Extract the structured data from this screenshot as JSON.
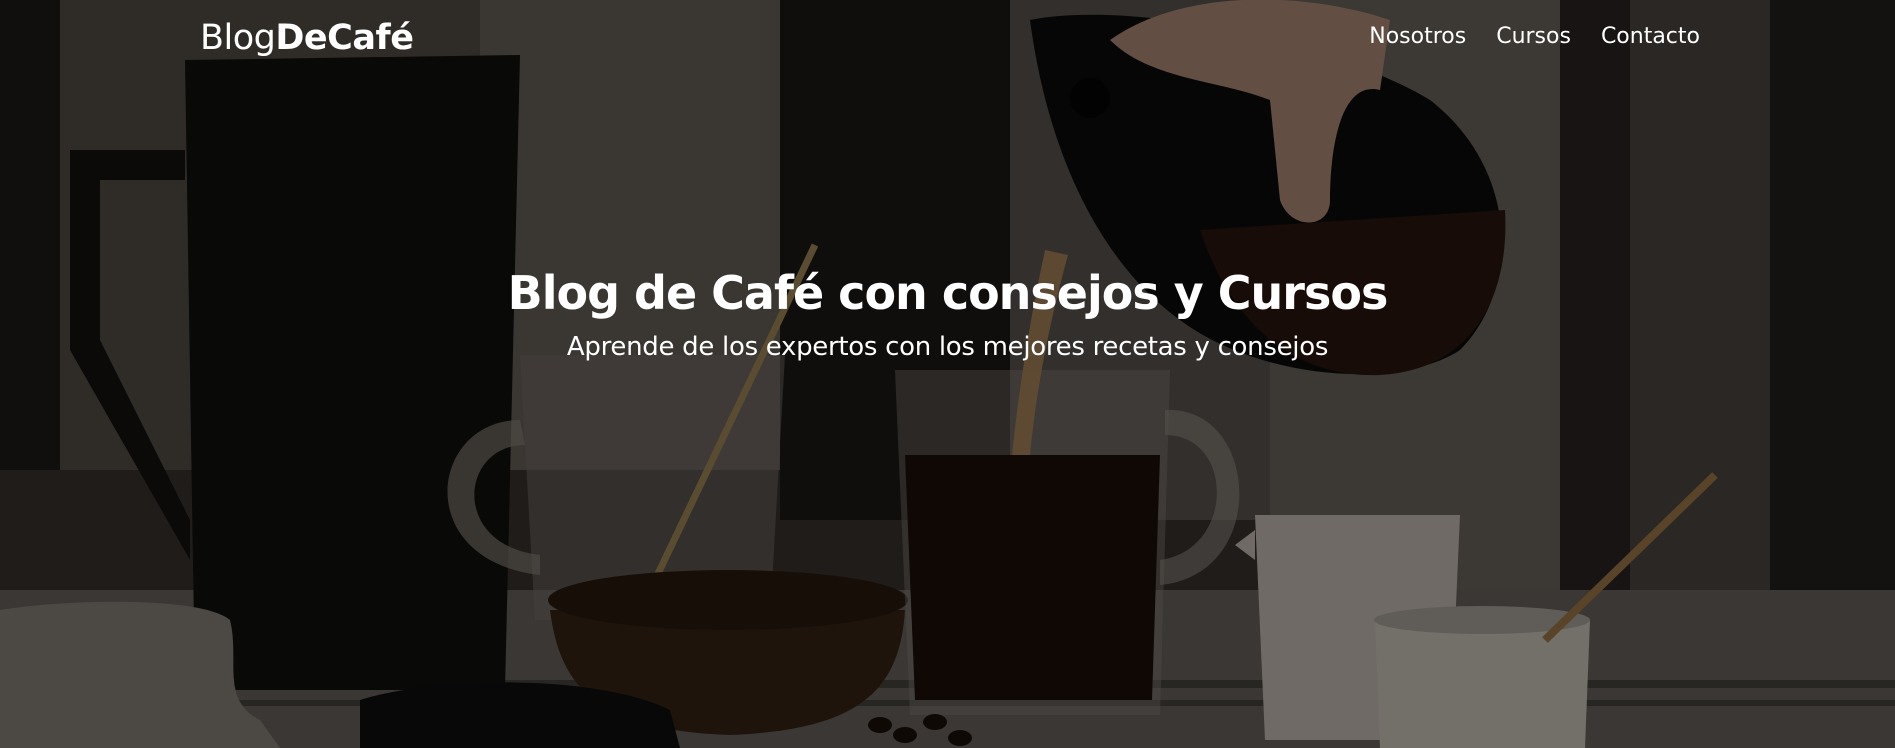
{
  "header": {
    "logo_light": "Blog",
    "logo_bold": "DeCafé",
    "nav": [
      {
        "label": "Nosotros"
      },
      {
        "label": "Cursos"
      },
      {
        "label": "Contacto"
      }
    ]
  },
  "hero": {
    "title": "Blog de Café con consejos y Cursos",
    "subtitle": "Aprende de los expertos con los mejores recetas y consejos",
    "background_icon": "coffee-pouring-photo"
  },
  "colors": {
    "text": "#ffffff",
    "overlay": "#000000"
  }
}
